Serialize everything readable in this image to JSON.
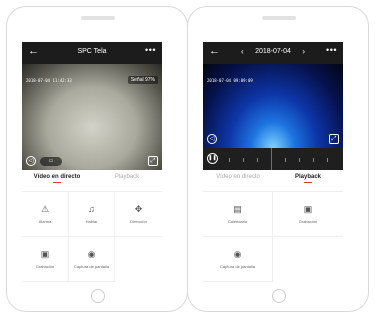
{
  "left_screen": {
    "header": {
      "back_icon": "arrow-left-icon",
      "title": "SPC Tela",
      "more_icon": "more-icon"
    },
    "video": {
      "timestamp": "2018-07-04 11:42:33",
      "signal": "Señal 97%"
    },
    "tabs": [
      {
        "label": "Vídeo en directo",
        "active": true
      },
      {
        "label": "Playback",
        "active": false
      }
    ],
    "controls": [
      {
        "label": "Alarma",
        "icon": "alarm-icon"
      },
      {
        "label": "Hablar",
        "icon": "microphone-icon"
      },
      {
        "label": "Dirección",
        "icon": "direction-icon"
      },
      {
        "label": "Grabación",
        "icon": "record-icon"
      },
      {
        "label": "Captura de pantalla",
        "icon": "camera-icon"
      }
    ]
  },
  "right_screen": {
    "header": {
      "back_icon": "arrow-left-icon",
      "date": "2018-07-04",
      "more_icon": "more-icon"
    },
    "video": {
      "timestamp": "2018-07-04 09:09:09"
    },
    "tabs": [
      {
        "label": "Vídeo en directo",
        "active": false
      },
      {
        "label": "Playback",
        "active": true
      }
    ],
    "controls": [
      {
        "label": "Calendario",
        "icon": "calendar-icon"
      },
      {
        "label": "Grabación",
        "icon": "record-icon"
      },
      {
        "label": "Captura de pantalla",
        "icon": "camera-icon"
      }
    ]
  }
}
